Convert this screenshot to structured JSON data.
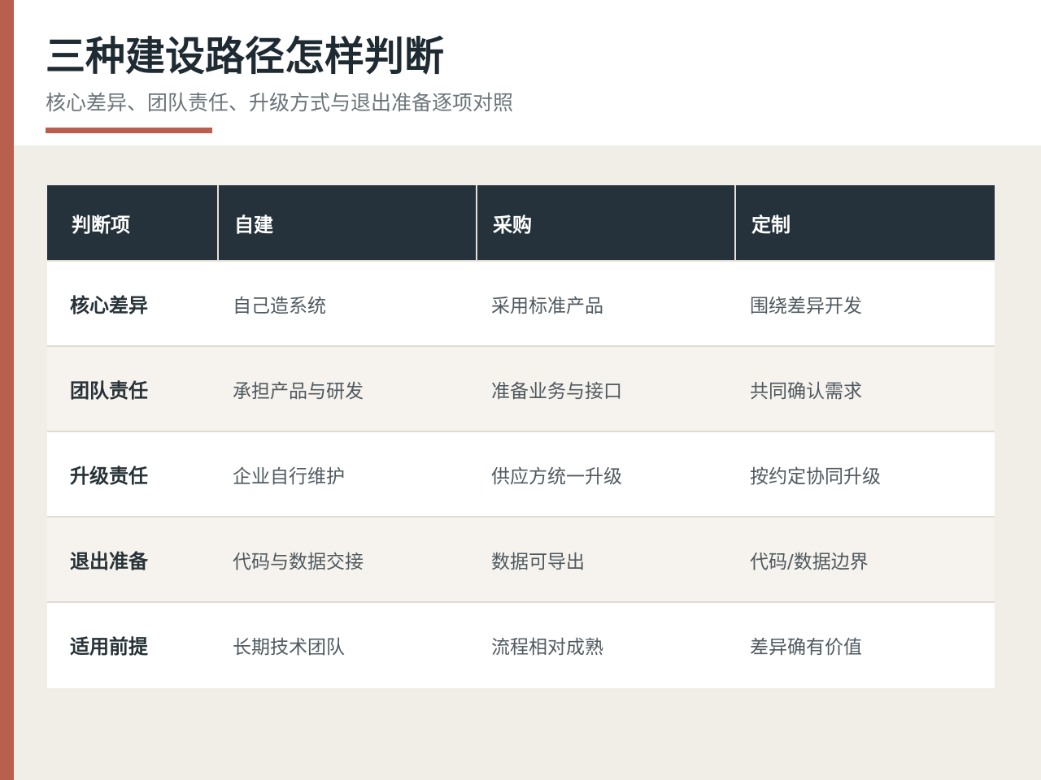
{
  "title": "三种建设路径怎样判断",
  "subtitle": "核心差异、团队责任、升级方式与退出准备逐项对照",
  "colors": {
    "accent": "#b95f4d",
    "header_background": "#25323b",
    "page_background": "#f1eee8",
    "alternate_row": "#f6f2ed"
  },
  "table": {
    "headers": [
      "判断项",
      "自建",
      "采购",
      "定制"
    ],
    "rows": [
      [
        "核心差异",
        "自己造系统",
        "采用标准产品",
        "围绕差异开发"
      ],
      [
        "团队责任",
        "承担产品与研发",
        "准备业务与接口",
        "共同确认需求"
      ],
      [
        "升级责任",
        "企业自行维护",
        "供应方统一升级",
        "按约定协同升级"
      ],
      [
        "退出准备",
        "代码与数据交接",
        "数据可导出",
        "代码/数据边界"
      ],
      [
        "适用前提",
        "长期技术团队",
        "流程相对成熟",
        "差异确有价值"
      ]
    ]
  }
}
